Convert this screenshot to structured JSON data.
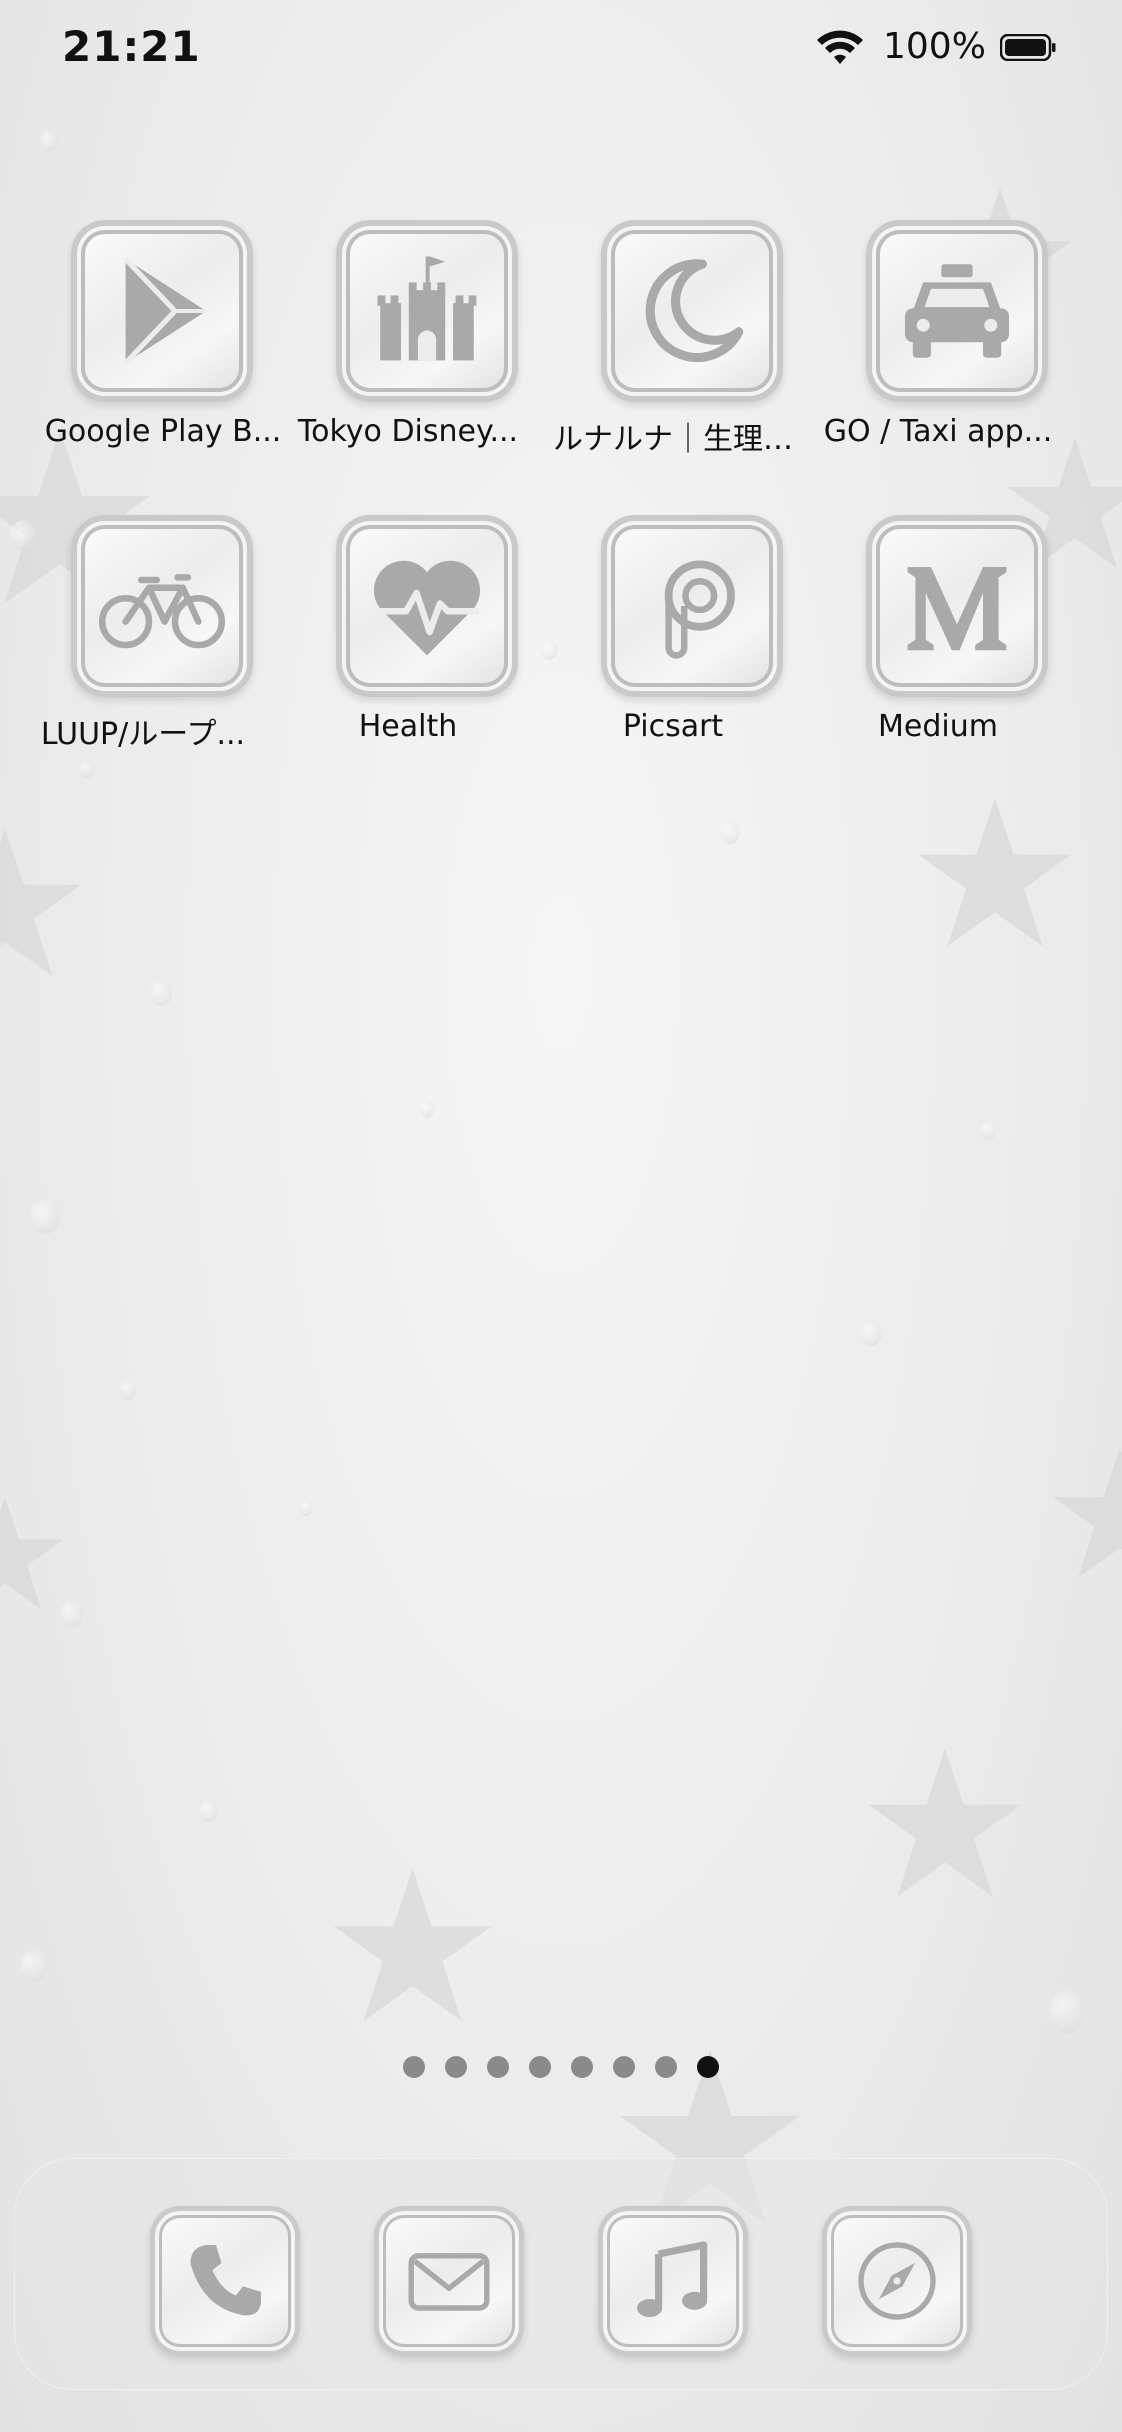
{
  "status_bar": {
    "time": "21:21",
    "battery_percent": "100%",
    "wifi_icon": "wifi-icon",
    "battery_icon": "battery-full-icon"
  },
  "apps": [
    {
      "label": "Google Play B...",
      "icon": "google-play-books-icon"
    },
    {
      "label": "Tokyo Disney...",
      "icon": "castle-icon"
    },
    {
      "label": "ルナルナ｜生理…",
      "icon": "crescent-moon-icon"
    },
    {
      "label": "GO / Taxi app...",
      "icon": "taxi-icon"
    },
    {
      "label": "LUUP/ループ...",
      "icon": "bicycle-icon"
    },
    {
      "label": "Health",
      "icon": "heart-pulse-icon"
    },
    {
      "label": "Picsart",
      "icon": "picsart-icon"
    },
    {
      "label": "Medium",
      "icon": "medium-icon"
    }
  ],
  "page_dots": {
    "count": 8,
    "active_index": 7
  },
  "dock": [
    {
      "name": "phone",
      "icon": "phone-icon"
    },
    {
      "name": "mail",
      "icon": "mail-icon"
    },
    {
      "name": "music",
      "icon": "music-note-icon"
    },
    {
      "name": "safari",
      "icon": "compass-icon"
    }
  ],
  "colors": {
    "icon_glyph": "#a9a9a9",
    "text": "#111111",
    "dot_inactive": "#8a8a8a",
    "dot_active": "#111111"
  }
}
